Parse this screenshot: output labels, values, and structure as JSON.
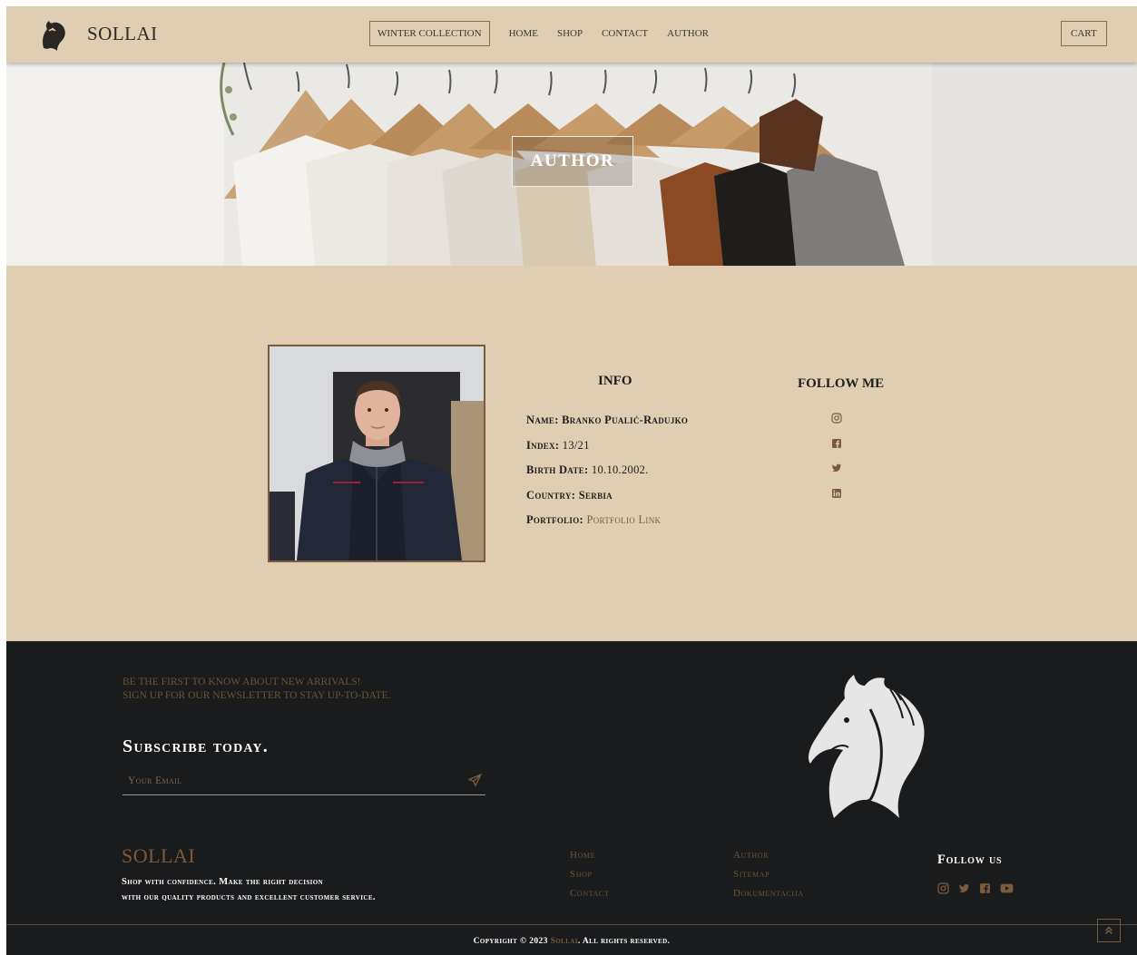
{
  "nav": {
    "brand": "SOLLAI",
    "links": [
      "WINTER COLLECTION",
      "HOME",
      "SHOP",
      "CONTACT",
      "AUTHOR"
    ],
    "cart": "CART",
    "logo_icon": "horse-head-icon"
  },
  "hero": {
    "title": "AUTHOR"
  },
  "author": {
    "info_title": "INFO",
    "rows": [
      {
        "label": "Name:",
        "value": "Branko Pualić-Radujko"
      },
      {
        "label": "Index:",
        "value": "13/21"
      },
      {
        "label": "Birth Date:",
        "value": "10.10.2002."
      },
      {
        "label": "Country:",
        "value": "Serbia"
      },
      {
        "label": "Portfolio:",
        "value": "Portfolio Link"
      }
    ],
    "follow_title": "FOLLOW ME",
    "follow_icons": [
      "instagram-icon",
      "facebook-icon",
      "twitter-icon",
      "linkedin-icon"
    ]
  },
  "footer": {
    "newsletter_line1": "BE THE FIRST TO KNOW ABOUT NEW ARRIVALS!",
    "newsletter_line2": "SIGN UP FOR OUR NEWSLETTER TO STAY UP-TO-DATE.",
    "subscribe_title": "Subscribe today.",
    "email_placeholder": "Your Email",
    "brand": "SOLLAI",
    "tagline_line1": "Shop with confidence. Make the right decision",
    "tagline_line2": "with our quality products and excellent customer service.",
    "col1": [
      "Home",
      "Shop",
      "Contact"
    ],
    "col2": [
      "Author",
      "Sitemap",
      "Dokumentacija"
    ],
    "follow_title": "Follow us",
    "follow_icons": [
      "instagram-icon",
      "twitter-icon",
      "facebook-icon",
      "youtube-icon"
    ],
    "copyright_pre": "Copyright © 2023",
    "copyright_brand": "Sollai",
    "copyright_post": ". All rights reserved."
  },
  "colors": {
    "beige": "#dfceb2",
    "dark": "#1a1b1d",
    "accent": "#7a5c3c"
  }
}
